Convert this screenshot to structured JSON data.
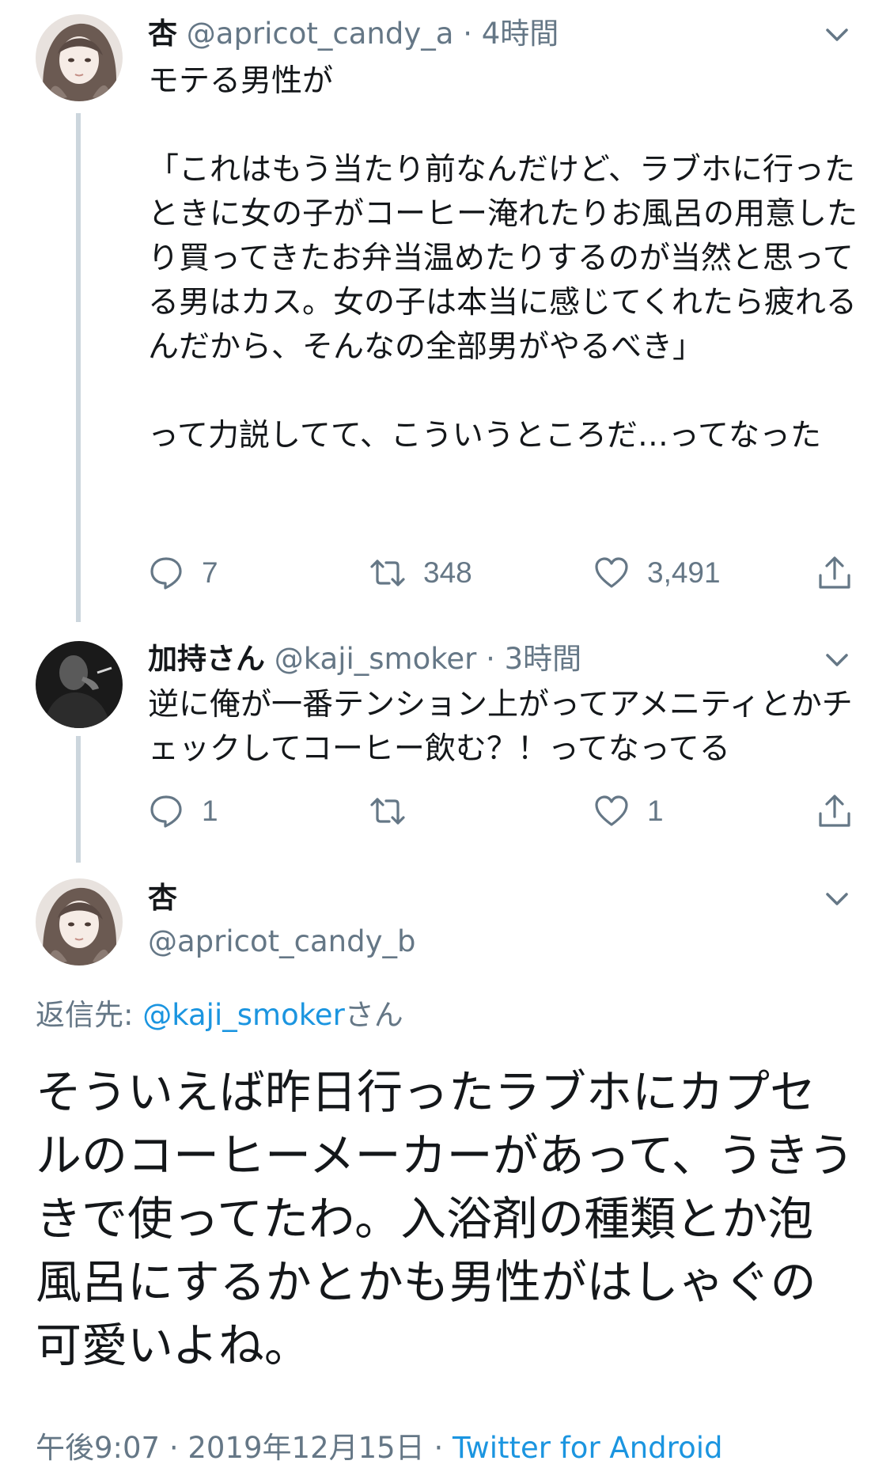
{
  "tweets": [
    {
      "display_name": "杏",
      "handle": "@apricot_candy_a",
      "separator": "·",
      "time": "4時間",
      "text": "モテる男性が\n\n「これはもう当たり前なんだけど、ラブホに行ったときに女の子がコーヒー淹れたりお風呂の用意したり買ってきたお弁当温めたりするのが当然と思ってる男はカス。女の子は本当に感じてくれたら疲れるんだから、そんなの全部男がやるべき」\n\nって力説してて、こういうところだ…ってなった",
      "replies": "7",
      "retweets": "348",
      "likes": "3,491"
    },
    {
      "display_name": "加持さん",
      "handle": "@kaji_smoker",
      "separator": "·",
      "time": "3時間",
      "text": "逆に俺が一番テンション上がってアメニティとかチェックしてコーヒー飲む？！ってなってる",
      "replies": "1",
      "retweets": "",
      "likes": "1"
    }
  ],
  "focused": {
    "display_name": "杏",
    "handle": "@apricot_candy_b",
    "reply_label": "返信先: ",
    "reply_handle": "@kaji_smoker",
    "reply_suffix": "さん",
    "text": "そういえば昨日行ったラブホにカプセルのコーヒーメーカーがあって、うきうきで使ってたわ。入浴剤の種類とか泡風呂にするかとかも男性がはしゃぐの可愛いよね。",
    "time": "午後9:07",
    "separator": "·",
    "date": "2019年12月15日",
    "separator2": "·",
    "client": "Twitter for Android"
  },
  "colors": {
    "text": "#14171a",
    "secondary": "#657786",
    "link": "#1b95e0",
    "thread_line": "#ccd6dd"
  },
  "icons": [
    "chevron-down-icon",
    "reply-icon",
    "retweet-icon",
    "like-icon",
    "share-icon"
  ]
}
